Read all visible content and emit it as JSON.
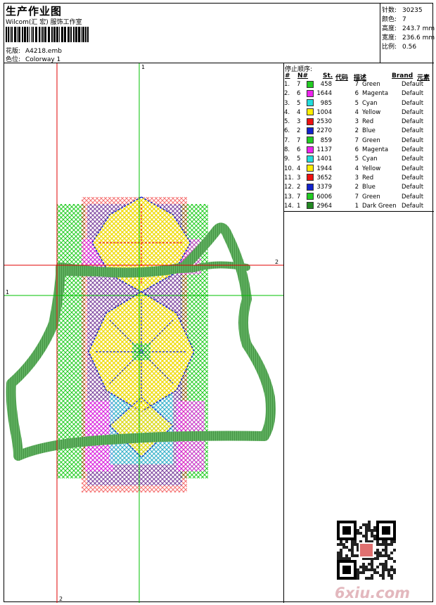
{
  "header": {
    "title": "生产作业图",
    "subtitle": "Wilcom(汇 宏) 服饰工作室",
    "design_label": "花版:",
    "design_value": "A4218.emb",
    "colorway_label": "色位:",
    "colorway_value": "Colorway 1"
  },
  "stats": [
    {
      "label": "针数:",
      "value": "30235"
    },
    {
      "label": "颜色:",
      "value": "7"
    },
    {
      "label": "高度:",
      "value": "243.7 mm"
    },
    {
      "label": "宽度:",
      "value": "236.6 mm"
    },
    {
      "label": "比例:",
      "value": "0.56"
    }
  ],
  "canvas": {
    "guide_label_top": "1",
    "guide_label_left": "1",
    "guide_label_right": "2",
    "guide_label_bottom": "2"
  },
  "stop_sequence": {
    "title": "停止顺序:",
    "headers": {
      "num": "#",
      "needle": "N#",
      "stitches": "St.",
      "code": "代码",
      "desc": "描述",
      "brand": "Brand",
      "element": "元素"
    },
    "rows": [
      {
        "num": "1.",
        "needle": "7",
        "color": "#22cc22",
        "stitches": "458",
        "code": "7",
        "desc": "Green",
        "brand": "Default"
      },
      {
        "num": "2.",
        "needle": "6",
        "color": "#ee22ee",
        "stitches": "1644",
        "code": "6",
        "desc": "Magenta",
        "brand": "Default"
      },
      {
        "num": "3.",
        "needle": "5",
        "color": "#22dddd",
        "stitches": "985",
        "code": "5",
        "desc": "Cyan",
        "brand": "Default"
      },
      {
        "num": "4.",
        "needle": "4",
        "color": "#ffee00",
        "stitches": "1004",
        "code": "4",
        "desc": "Yellow",
        "brand": "Default"
      },
      {
        "num": "5.",
        "needle": "3",
        "color": "#ee1111",
        "stitches": "2530",
        "code": "3",
        "desc": "Red",
        "brand": "Default"
      },
      {
        "num": "6.",
        "needle": "2",
        "color": "#1122cc",
        "stitches": "2270",
        "code": "2",
        "desc": "Blue",
        "brand": "Default"
      },
      {
        "num": "7.",
        "needle": "7",
        "color": "#22cc22",
        "stitches": "859",
        "code": "7",
        "desc": "Green",
        "brand": "Default"
      },
      {
        "num": "8.",
        "needle": "6",
        "color": "#ee22ee",
        "stitches": "1137",
        "code": "6",
        "desc": "Magenta",
        "brand": "Default"
      },
      {
        "num": "9.",
        "needle": "5",
        "color": "#22dddd",
        "stitches": "1401",
        "code": "5",
        "desc": "Cyan",
        "brand": "Default"
      },
      {
        "num": "10.",
        "needle": "4",
        "color": "#ffee00",
        "stitches": "1944",
        "code": "4",
        "desc": "Yellow",
        "brand": "Default"
      },
      {
        "num": "11.",
        "needle": "3",
        "color": "#ee1111",
        "stitches": "3652",
        "code": "3",
        "desc": "Red",
        "brand": "Default"
      },
      {
        "num": "12.",
        "needle": "2",
        "color": "#1122cc",
        "stitches": "3379",
        "code": "2",
        "desc": "Blue",
        "brand": "Default"
      },
      {
        "num": "13.",
        "needle": "7",
        "color": "#22cc22",
        "stitches": "6006",
        "code": "7",
        "desc": "Green",
        "brand": "Default"
      },
      {
        "num": "14.",
        "needle": "1",
        "color": "#228822",
        "stitches": "2964",
        "code": "1",
        "desc": "Dark Green",
        "brand": "Default"
      }
    ]
  },
  "watermark": {
    "site": "6xiu.com"
  }
}
